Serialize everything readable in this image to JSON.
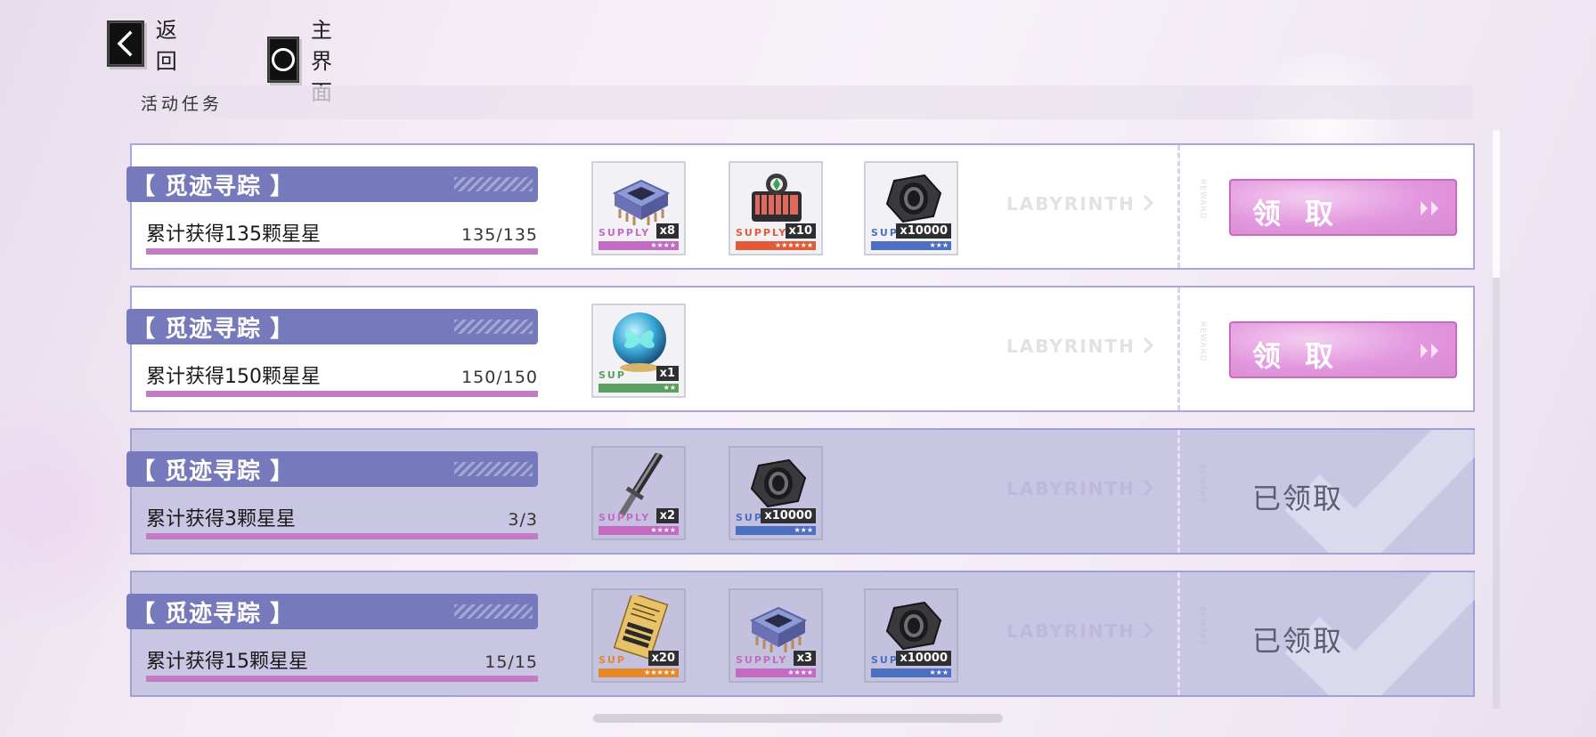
{
  "nav": {
    "back_label": "返回",
    "home_label": "主界面"
  },
  "section": {
    "title": "活动任务"
  },
  "tasks": [
    {
      "title": "【 觅迹寻踪 】",
      "description": "累计获得135颗星星",
      "progress_text": "135/135",
      "progress": 1.0,
      "status": "claimable",
      "claim_label": "领 取",
      "claimed_label": "已领取",
      "labyrinth": "LABYRINTH",
      "reward_tag": "REWARD",
      "items": [
        {
          "icon": "chip-module-icon",
          "supply": "SUPPLY",
          "qty": "x8",
          "stars": "★★★★",
          "color": "#c46ac2"
        },
        {
          "icon": "red-engine-icon",
          "supply": "SUPPLY",
          "qty": "x10",
          "stars": "★★★★★★",
          "color": "#e35a36"
        },
        {
          "icon": "hex-nut-icon",
          "supply": "SUPP",
          "qty": "x10000",
          "stars": "★★★",
          "color": "#4c6fc1"
        }
      ]
    },
    {
      "title": "【 觅迹寻踪 】",
      "description": "累计获得150颗星星",
      "progress_text": "150/150",
      "progress": 1.0,
      "status": "claimable",
      "claim_label": "领 取",
      "claimed_label": "已领取",
      "labyrinth": "LABYRINTH",
      "reward_tag": "REWARD",
      "items": [
        {
          "icon": "butterfly-orb-icon",
          "supply": "SUP",
          "qty": "x1",
          "stars": "★★",
          "color": "#5aa060"
        }
      ]
    },
    {
      "title": "【 觅迹寻踪 】",
      "description": "累计获得3颗星星",
      "progress_text": "3/3",
      "progress": 1.0,
      "status": "claimed",
      "claim_label": "领 取",
      "claimed_label": "已领取",
      "labyrinth": "LABYRINTH",
      "reward_tag": "REWARD",
      "items": [
        {
          "icon": "blade-icon",
          "supply": "SUPPLY",
          "qty": "x2",
          "stars": "★★★★",
          "color": "#c46ac2"
        },
        {
          "icon": "hex-nut-icon",
          "supply": "SUP",
          "qty": "x10000",
          "stars": "★★★",
          "color": "#4c6fc1"
        }
      ]
    },
    {
      "title": "【 觅迹寻踪 】",
      "description": "累计获得15颗星星",
      "progress_text": "15/15",
      "progress": 1.0,
      "status": "claimed",
      "claim_label": "领 取",
      "claimed_label": "已领取",
      "labyrinth": "LABYRINTH",
      "reward_tag": "REWARD",
      "items": [
        {
          "icon": "gold-document-icon",
          "supply": "SUP",
          "qty": "x20",
          "stars": "★★★★★",
          "color": "#e6882a"
        },
        {
          "icon": "chip-module-icon",
          "supply": "SUPPLY",
          "qty": "x3",
          "stars": "★★★★",
          "color": "#c46ac2"
        },
        {
          "icon": "hex-nut-icon",
          "supply": "SUPP",
          "qty": "x10000",
          "stars": "★★★",
          "color": "#4c6fc1"
        }
      ]
    }
  ]
}
